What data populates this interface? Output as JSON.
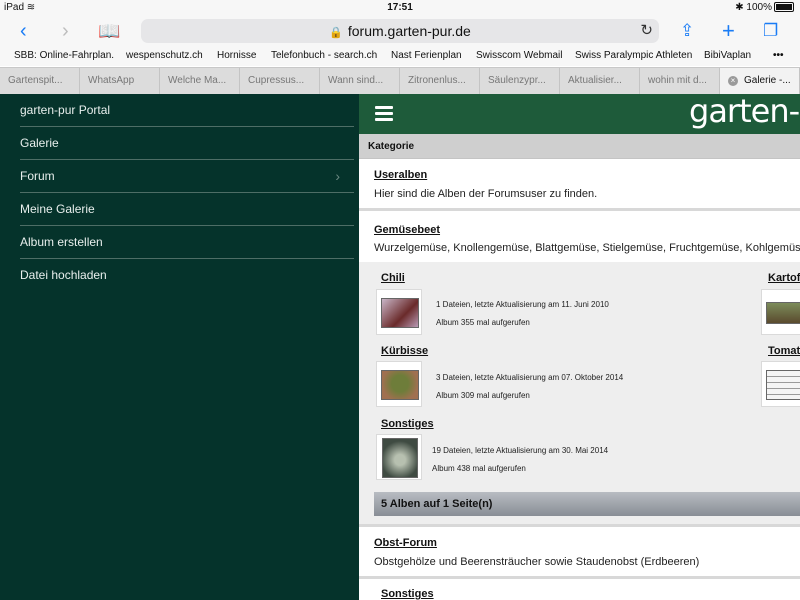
{
  "status_bar": {
    "device": "iPad",
    "time": "17:51",
    "battery": "100%"
  },
  "toolbar": {
    "url": "forum.garten-pur.de"
  },
  "bookmarks": [
    "SBB: Online-Fahrplan.",
    "wespenschutz.ch",
    "Hornisse",
    "Telefonbuch - search.ch",
    "Nast Ferienplan",
    "Swisscom Webmail",
    "Swiss Paralympic Athleten",
    "BibiVaplan"
  ],
  "tabs": [
    "Gartenspit...",
    "WhatsApp",
    "Welche Ma...",
    "Cupressus...",
    "Wann sind...",
    "Zitronenlus...",
    "Säulenzypr...",
    "Aktualisier...",
    "wohin mit d...",
    "Galerie -..."
  ],
  "sidebar": {
    "items": [
      "garten-pur Portal",
      "Galerie",
      "Forum",
      "Meine Galerie",
      "Album erstellen",
      "Datei hochladen"
    ]
  },
  "site": {
    "brand": "garten-pur",
    "kategorie": "Kategorie",
    "useralben": {
      "title": "Useralben",
      "desc": "Hier sind die Alben der Forumsuser zu finden."
    },
    "gemuesebeet": {
      "title": "Gemüsebeet",
      "desc": "Wurzelgemüse, Knollengemüse, Blattgemüse, Stielgemüse, Fruchtgemüse, Kohlgemüse"
    },
    "albums": [
      {
        "title": "Chili",
        "info1": "1 Dateien, letzte Aktualisierung am 11. Juni 2010",
        "info2": "Album 355 mal aufgerufen"
      },
      {
        "title": "Kürbisse",
        "info1": "3 Dateien, letzte Aktualisierung am 07. Oktober 2014",
        "info2": "Album 309 mal aufgerufen"
      },
      {
        "title": "Sonstiges",
        "info1": "19 Dateien, letzte Aktualisierung am 30. Mai 2014",
        "info2": "Album 438 mal aufgerufen"
      },
      {
        "title": "Kartof"
      },
      {
        "title": "Tomat"
      }
    ],
    "albums_footer": "5 Alben auf 1 Seite(n)",
    "obst": {
      "title": "Obst-Forum",
      "desc": "Obstgehölze und Beerensträucher sowie Staudenobst (Erdbeeren)"
    },
    "sonstiges": {
      "title": "Sonstiges"
    }
  }
}
